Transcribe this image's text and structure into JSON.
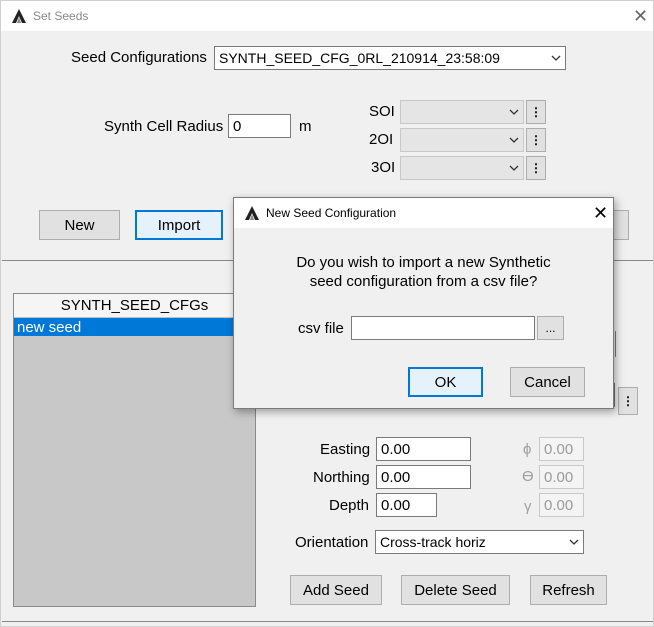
{
  "window": {
    "title": "Set Seeds"
  },
  "seed_config": {
    "label": "Seed Configurations",
    "selected": "SYNTH_SEED_CFG_0RL_210914_23:58:09"
  },
  "synth_cell_radius": {
    "label": "Synth Cell Radius",
    "value": "0",
    "unit": "m"
  },
  "oi_rows": [
    {
      "label": "SOI",
      "value": ""
    },
    {
      "label": "2OI",
      "value": ""
    },
    {
      "label": "3OI",
      "value": ""
    }
  ],
  "buttons": {
    "new": "New",
    "import": "Import"
  },
  "list": {
    "header": "SYNTH_SEED_CFGs",
    "items": [
      "new seed"
    ]
  },
  "position": {
    "easting_label": "Easting",
    "easting": "0.00",
    "northing_label": "Northing",
    "northing": "0.00",
    "depth_label": "Depth",
    "depth": "0.00"
  },
  "angles": {
    "phi_symbol": "ϕ",
    "phi": "0.00",
    "theta_symbol": "ϴ",
    "theta": "0.00",
    "gamma_symbol": "γ",
    "gamma": "0.00"
  },
  "orientation": {
    "label": "Orientation",
    "selected": "Cross-track horiz"
  },
  "actions": {
    "add_seed": "Add Seed",
    "delete_seed": "Delete Seed",
    "refresh": "Refresh"
  },
  "dialog": {
    "title": "New Seed Configuration",
    "message_line1": "Do you wish to import a new Synthetic",
    "message_line2": "seed configuration from a csv file?",
    "csv_label": "csv file",
    "csv_value": "",
    "browse": "...",
    "ok": "OK",
    "cancel": "Cancel"
  },
  "colors": {
    "accent": "#0078d7",
    "window_bg": "#f0f0f0"
  },
  "icons": [
    "app-logo-icon",
    "close-icon",
    "chevron-down-icon",
    "ellipsis-icon"
  ]
}
